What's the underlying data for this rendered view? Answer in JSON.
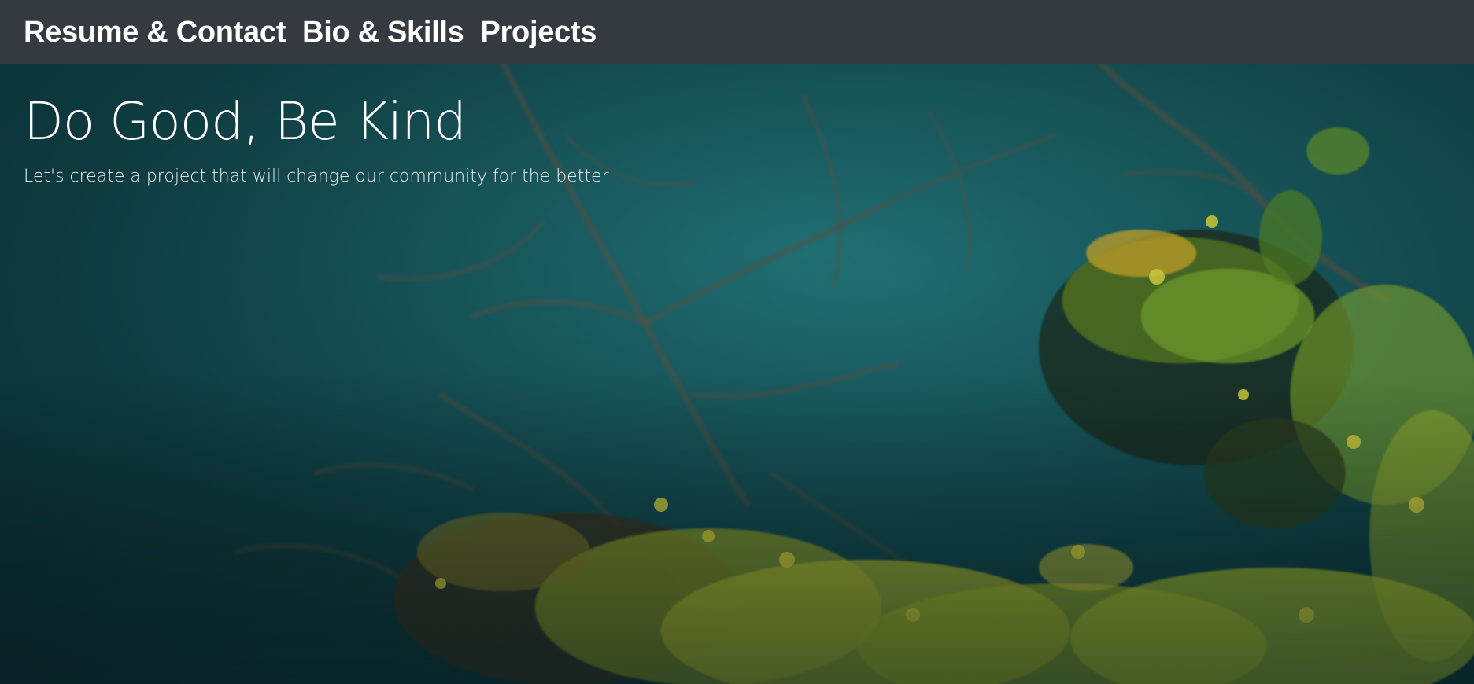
{
  "nav": {
    "items": [
      {
        "label": "Resume & Contact"
      },
      {
        "label": "Bio & Skills"
      },
      {
        "label": "Projects"
      }
    ]
  },
  "hero": {
    "title": "Do Good, Be Kind",
    "subtitle": "Let's create a project that will change our community for the better",
    "image": "water-with-submerged-branches-and-green-leaves"
  },
  "colors": {
    "navbar_bg": "#343a40",
    "nav_text": "#ffffff",
    "water_teal": "#165257",
    "foliage_yellow_green": "#a9b52c"
  }
}
